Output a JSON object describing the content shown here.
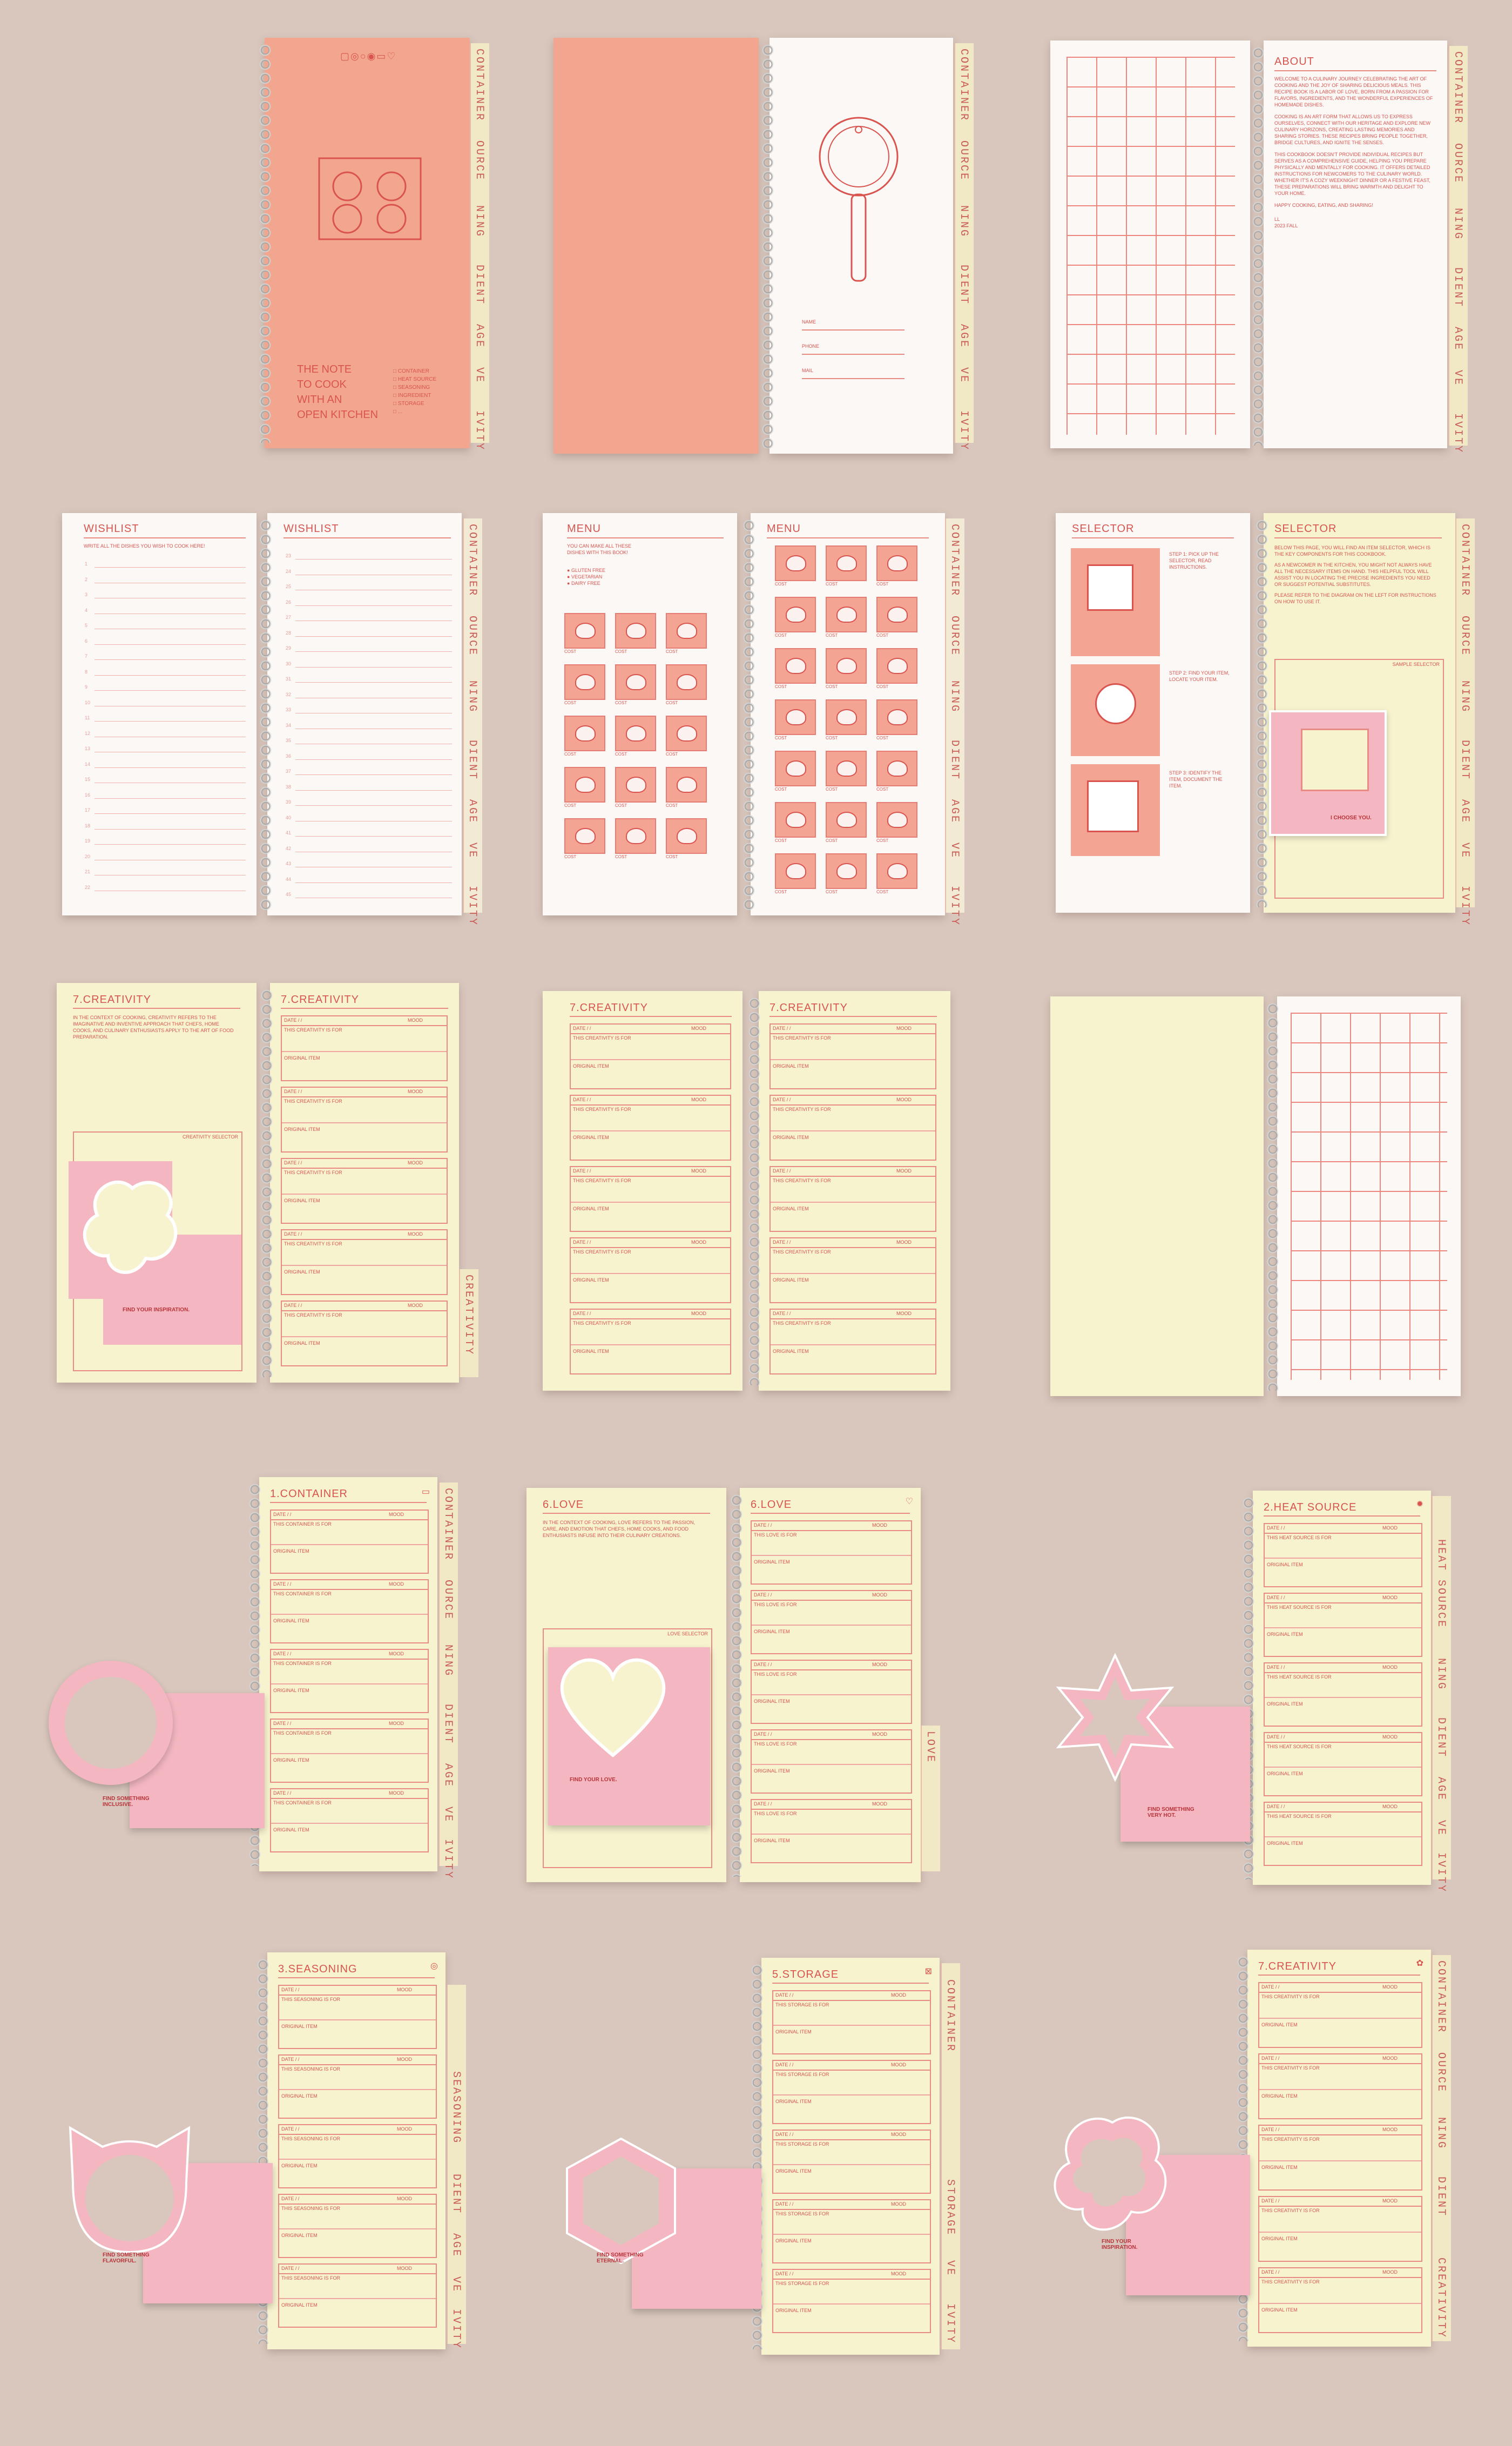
{
  "tabs": {
    "container": "CONTAINER",
    "heat": "OURCE",
    "heat_full": "HEAT SOURCE",
    "seasoning": "SEASONING",
    "seasoning_short": "NING",
    "ingredient": "DIENT",
    "storage_short": "AGE",
    "storage": "STORAGE",
    "love_short": "VE",
    "love": "LOVE",
    "creativity_short": "IVITY",
    "creativity": "CREATIVITY"
  },
  "cover": {
    "title_lines": [
      "THE NOTE",
      "TO COOK",
      "WITH AN",
      "OPEN KITCHEN"
    ],
    "checklist": [
      "CONTAINER",
      "HEAT SOURCE",
      "SEASONING",
      "INGREDIENT",
      "STORAGE",
      "..."
    ]
  },
  "owner": {
    "name": "NAME",
    "phone": "PHONE",
    "mail": "MAIL"
  },
  "about": {
    "title": "ABOUT",
    "paragraphs": [
      "WELCOME TO A CULINARY JOURNEY CELEBRATING THE ART OF COOKING AND THE JOY OF SHARING DELICIOUS MEALS. THIS RECIPE BOOK IS A LABOR OF LOVE, BORN FROM A PASSION FOR FLAVORS, INGREDIENTS, AND THE WONDERFUL EXPERIENCES OF HOMEMADE DISHES.",
      "COOKING IS AN ART FORM THAT ALLOWS US TO EXPRESS OURSELVES, CONNECT WITH OUR HERITAGE AND EXPLORE NEW CULINARY HORIZONS, CREATING LASTING MEMORIES AND SHARING STORIES. THESE RECIPES BRING PEOPLE TOGETHER, BRIDGE CULTURES, AND IGNITE THE SENSES.",
      "THIS COOKBOOK DOESN'T PROVIDE INDIVIDUAL RECIPES BUT SERVES AS A COMPREHENSIVE GUIDE, HELPING YOU PREPARE PHYSICALLY AND MENTALLY FOR COOKING. IT OFFERS DETAILED INSTRUCTIONS FOR NEWCOMERS TO THE CULINARY WORLD. WHETHER IT'S A COZY WEEKNIGHT DINNER OR A FESTIVE FEAST, THESE PREPARATIONS WILL BRING WARMTH AND DELIGHT TO YOUR HOME.",
      "HAPPY COOKING, EATING, AND SHARING!"
    ],
    "sign": "LL",
    "date": "2023 FALL"
  },
  "wishlist": {
    "title": "WISHLIST",
    "intro": "WRITE ALL THE DISHES YOU WISH TO COOK HERE!"
  },
  "menu": {
    "title": "MENU",
    "intro": "YOU CAN MAKE ALL THESE DISHES WITH THIS BOOK!",
    "legend": [
      "GLUTEN FREE",
      "VEGETARIAN",
      "DAIRY FREE"
    ],
    "cost": "COST"
  },
  "selector": {
    "title": "SELECTOR",
    "steps": [
      "STEP 1: PICK UP THE SELECTOR, READ INSTRUCTIONS.",
      "STEP 2: FIND YOUR ITEM, LOCATE YOUR ITEM.",
      "STEP 3: IDENTIFY THE ITEM, DOCUMENT THE ITEM."
    ],
    "intro": "BELOW THIS PAGE, YOU WILL FIND AN ITEM SELECTOR, WHICH IS THE KEY COMPONENTS FOR THIS COOKBOOK.",
    "intro2": "AS A NEWCOMER IN THE KITCHEN, YOU MIGHT NOT ALWAYS HAVE ALL THE NECESSARY ITEMS ON HAND. THIS HELPFUL TOOL WILL ASSIST YOU IN LOCATING THE PRECISE INGREDIENTS YOU NEED OR SUGGEST POTENTIAL SUBSTITUTES.",
    "intro3": "PLEASE REFER TO THE DIAGRAM ON THE LEFT FOR INSTRUCTIONS ON HOW TO USE IT.",
    "sample": "SAMPLE SELECTOR",
    "choose": "I CHOOSE YOU."
  },
  "creativity": {
    "title": "7.CREATIVITY",
    "intro": "IN THE CONTEXT OF COOKING, CREATIVITY REFERS TO THE IMAGINATIVE AND INVENTIVE APPROACH THAT CHEFS, HOME COOKS, AND CULINARY ENTHUSIASTS APPLY TO THE ART OF FOOD PREPARATION.",
    "selector": "CREATIVITY SELECTOR",
    "find": "FIND YOUR INSPIRATION.",
    "for": "THIS CREATIVITY IS FOR"
  },
  "entry": {
    "date": "DATE",
    "mood": "MOOD",
    "original": "ORIGINAL ITEM"
  },
  "container": {
    "title": "1.CONTAINER",
    "for": "THIS CONTAINER IS FOR",
    "find": "FIND SOMETHING INCLUSIVE."
  },
  "love": {
    "title": "6.LOVE",
    "intro": "IN THE CONTEXT OF COOKING, LOVE REFERS TO THE PASSION, CARE, AND EMOTION THAT CHEFS, HOME COOKS, AND FOOD ENTHUSIASTS INFUSE INTO THEIR CULINARY CREATIONS.",
    "selector": "LOVE SELECTOR",
    "for": "THIS LOVE IS FOR",
    "find": "FIND YOUR LOVE."
  },
  "heat": {
    "title": "2.HEAT SOURCE",
    "for": "THIS HEAT SOURCE IS FOR",
    "find": "FIND SOMETHING VERY HOT."
  },
  "seasoning": {
    "title": "3.SEASONING",
    "for": "THIS SEASONING IS FOR",
    "find": "FIND SOMETHING FLAVORFUL."
  },
  "storage": {
    "title": "5.STORAGE",
    "for": "THIS STORAGE IS FOR",
    "find": "FIND SOMETHING ETERNAL."
  },
  "colors": {
    "background": "#d9c7bd",
    "salmon": "#f3a68f",
    "cream": "#f7f3cf",
    "red": "#d9544e",
    "pink": "#f4b7c1"
  }
}
